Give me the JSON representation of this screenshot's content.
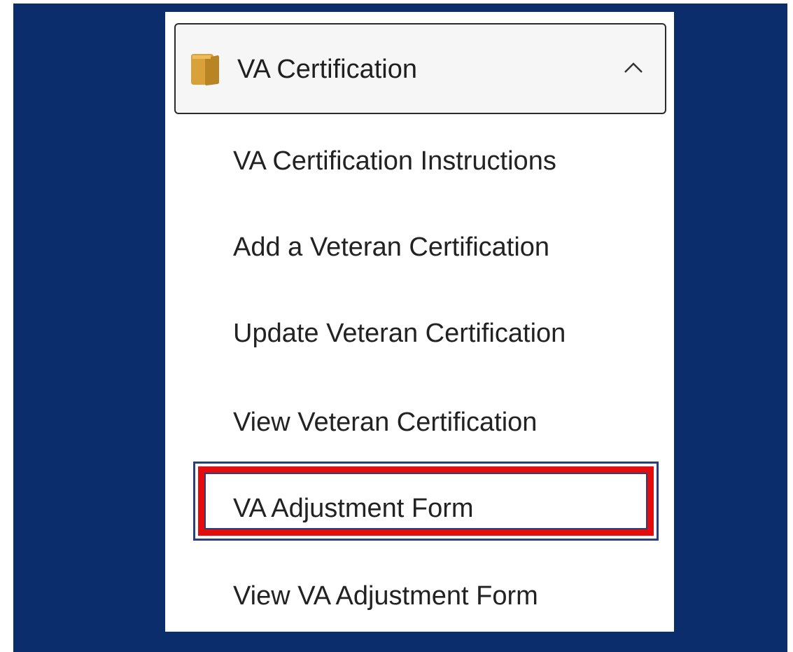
{
  "folder": {
    "title": "VA Certification",
    "icon": "folder-icon",
    "expanded": true,
    "chevron": "chevron-up-icon"
  },
  "menu": {
    "items": [
      {
        "label": "VA Certification Instructions"
      },
      {
        "label": "Add a Veteran Certification"
      },
      {
        "label": "Update Veteran Certification"
      },
      {
        "label": "View Veteran Certification"
      },
      {
        "label": "VA Adjustment Form",
        "highlighted": true
      },
      {
        "label": "View VA Adjustment Form"
      }
    ]
  },
  "colors": {
    "background": "#0b2d6b",
    "highlight": "#e40d0d",
    "folder_icon": "#e2a937"
  }
}
